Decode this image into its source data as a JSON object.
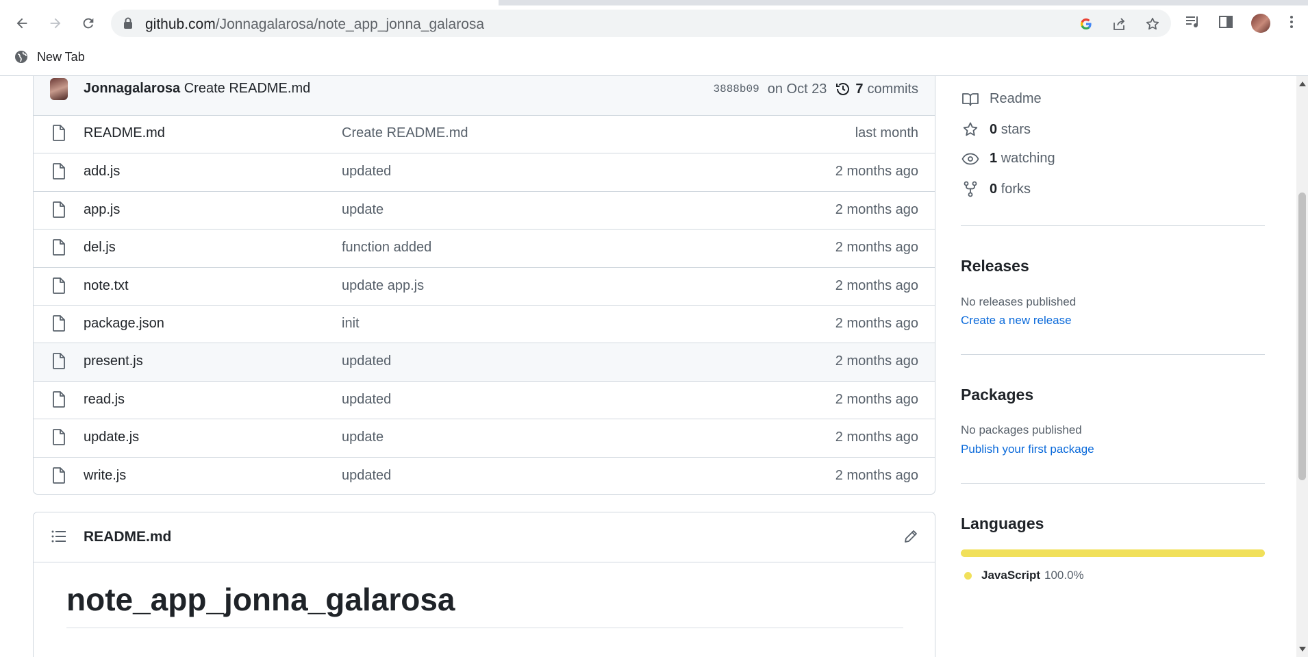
{
  "browser": {
    "url_host": "github.com",
    "url_path": "/Jonnagalarosa/note_app_jonna_galarosa",
    "bookmark_label": "New Tab"
  },
  "commit": {
    "author": "Jonnagalarosa",
    "message": "Create README.md",
    "sha": "3888b09",
    "date": "on Oct 23",
    "commit_count": "7",
    "commits_label": "commits"
  },
  "files": [
    {
      "name": "README.md",
      "message": "Create README.md",
      "age": "last month"
    },
    {
      "name": "add.js",
      "message": "updated",
      "age": "2 months ago"
    },
    {
      "name": "app.js",
      "message": "update",
      "age": "2 months ago"
    },
    {
      "name": "del.js",
      "message": "function added",
      "age": "2 months ago"
    },
    {
      "name": "note.txt",
      "message": "update app.js",
      "age": "2 months ago"
    },
    {
      "name": "package.json",
      "message": "init",
      "age": "2 months ago"
    },
    {
      "name": "present.js",
      "message": "updated",
      "age": "2 months ago"
    },
    {
      "name": "read.js",
      "message": "updated",
      "age": "2 months ago"
    },
    {
      "name": "update.js",
      "message": "update",
      "age": "2 months ago"
    },
    {
      "name": "write.js",
      "message": "updated",
      "age": "2 months ago"
    }
  ],
  "readme": {
    "file_label": "README.md",
    "heading": "note_app_jonna_galarosa"
  },
  "sidebar": {
    "readme_label": "Readme",
    "stars_count": "0",
    "stars_label": "stars",
    "watching_count": "1",
    "watching_label": "watching",
    "forks_count": "0",
    "forks_label": "forks",
    "releases_title": "Releases",
    "releases_text": "No releases published",
    "releases_link": "Create a new release",
    "packages_title": "Packages",
    "packages_text": "No packages published",
    "packages_link": "Publish your first package",
    "languages_title": "Languages",
    "language_name": "JavaScript",
    "language_percent": "100.0%",
    "language_color": "#f1e05a"
  }
}
